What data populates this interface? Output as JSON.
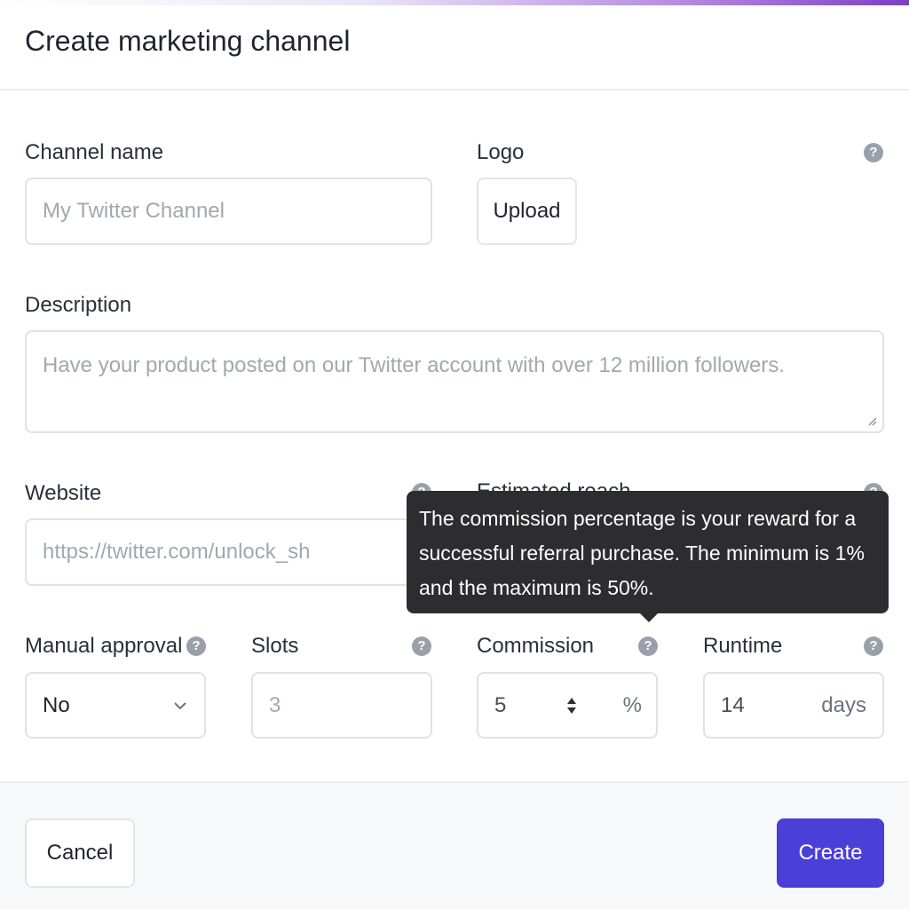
{
  "dialog": {
    "title": "Create marketing channel"
  },
  "channel_name": {
    "label": "Channel name",
    "placeholder": "My Twitter Channel"
  },
  "logo": {
    "label": "Logo",
    "upload_label": "Upload",
    "help_icon": "?"
  },
  "description": {
    "label": "Description",
    "placeholder": "Have your product posted on our Twitter account with over 12 million followers."
  },
  "website": {
    "label": "Website",
    "placeholder": "https://twitter.com/unlock_sh",
    "help_icon": "?"
  },
  "estimated_reach": {
    "label": "Estimated reach",
    "help_icon": "?"
  },
  "tooltip": {
    "text": "The commission percentage is your reward for a successful referral purchase. The minimum is 1% and the maximum is 50%."
  },
  "manual_approval": {
    "label": "Manual approval",
    "value": "No",
    "help_icon": "?"
  },
  "slots": {
    "label": "Slots",
    "placeholder": "3",
    "help_icon": "?"
  },
  "commission": {
    "label": "Commission",
    "value": "5",
    "unit": "%",
    "help_icon": "?"
  },
  "runtime": {
    "label": "Runtime",
    "value": "14",
    "unit": "days",
    "help_icon": "?"
  },
  "footer": {
    "cancel_label": "Cancel",
    "create_label": "Create"
  },
  "colors": {
    "primary": "#4a3fd8",
    "tooltip_bg": "#2d2d2f",
    "help_icon": "#9aa0aa"
  }
}
